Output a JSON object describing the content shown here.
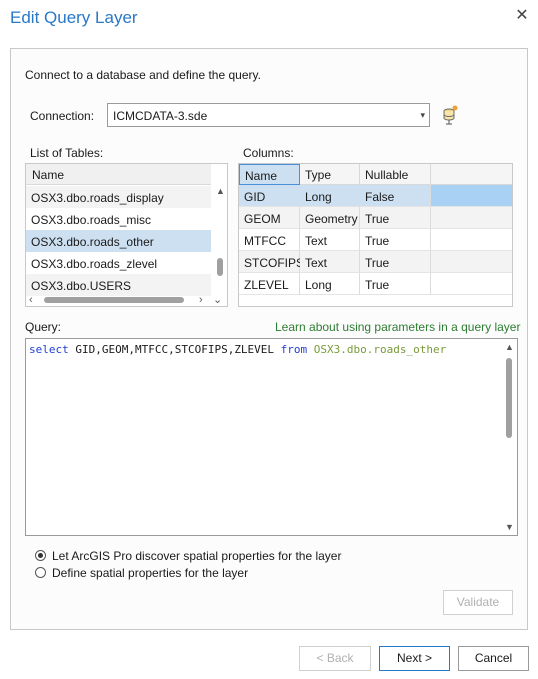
{
  "window": {
    "title": "Edit Query Layer"
  },
  "intro": "Connect to a database and define the query.",
  "connection": {
    "label": "Connection:",
    "value": "ICMCDATA-3.sde"
  },
  "tables": {
    "label": "List of Tables:",
    "header": "Name",
    "items": [
      "OSX3.dbo.roads_display",
      "OSX3.dbo.roads_misc",
      "OSX3.dbo.roads_other",
      "OSX3.dbo.roads_zlevel",
      "OSX3.dbo.USERS"
    ],
    "selected": "OSX3.dbo.roads_other"
  },
  "columns": {
    "label": "Columns:",
    "headers": [
      "Name",
      "Type",
      "Nullable"
    ],
    "rows": [
      [
        "GID",
        "Long",
        "False"
      ],
      [
        "GEOM",
        "Geometry",
        "True"
      ],
      [
        "MTFCC",
        "Text",
        "True"
      ],
      [
        "STCOFIPS",
        "Text",
        "True"
      ],
      [
        "ZLEVEL",
        "Long",
        "True"
      ]
    ]
  },
  "query": {
    "label": "Query:",
    "link": "Learn about using parameters in a query layer",
    "kw_select": "select",
    "fields": " GID,GEOM,MTFCC,STCOFIPS,ZLEVEL ",
    "kw_from": "from",
    "table": " OSX3.dbo.roads_other"
  },
  "spatial": {
    "option1": "Let ArcGIS Pro discover spatial properties for the layer",
    "option2": "Define spatial properties for the layer",
    "selected": 1
  },
  "buttons": {
    "validate": "Validate",
    "back": "< Back",
    "next": "Next >",
    "cancel": "Cancel"
  }
}
